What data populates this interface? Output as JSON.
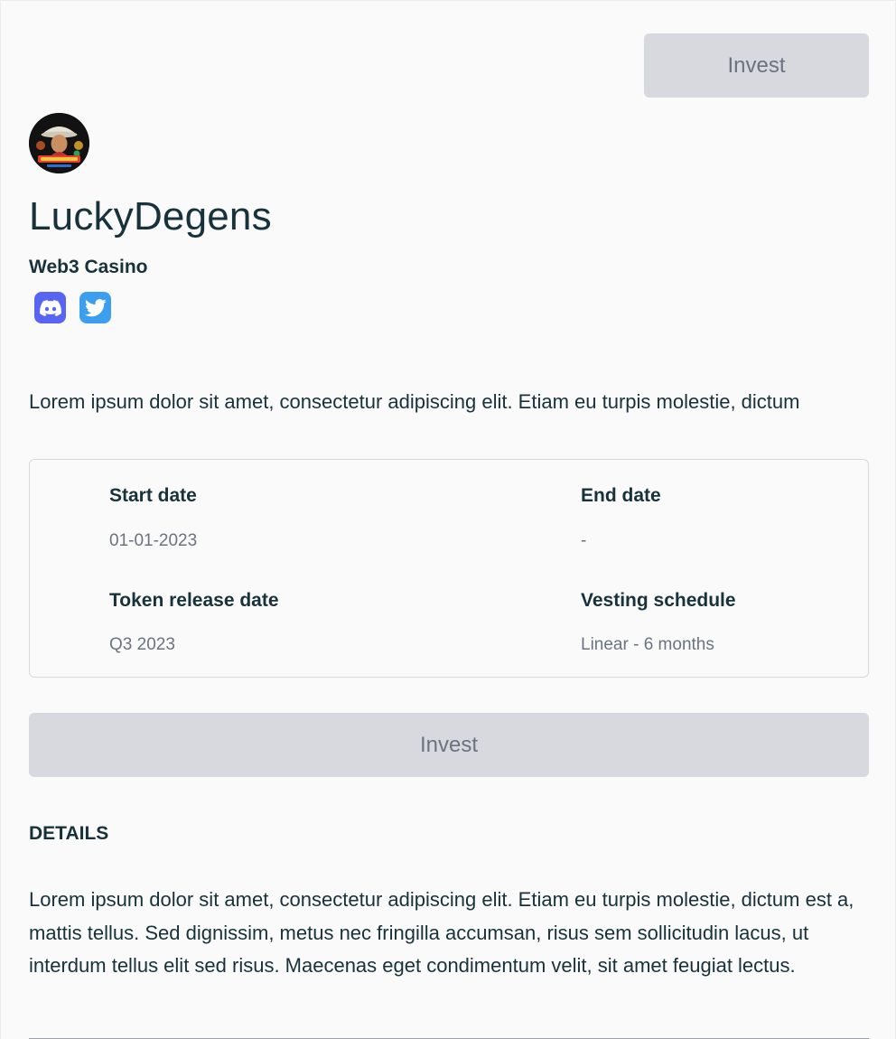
{
  "header": {
    "invest_label": "Invest"
  },
  "project": {
    "name": "LuckyDegens",
    "category": "Web3 Casino",
    "short_description": "Lorem ipsum dolor sit amet, consectetur adipiscing elit. Etiam eu turpis molestie, dictum",
    "socials": [
      {
        "icon": "discord-icon",
        "color": "#5865f2"
      },
      {
        "icon": "twitter-icon",
        "color": "#3d9ef0"
      }
    ]
  },
  "info": {
    "start_date_label": "Start date",
    "start_date_value": "01-01-2023",
    "end_date_label": "End date",
    "end_date_value": "-",
    "token_release_label": "Token release date",
    "token_release_value": "Q3 2023",
    "vesting_label": "Vesting schedule",
    "vesting_value": "Linear - 6 months"
  },
  "main": {
    "invest_label": "Invest"
  },
  "details": {
    "heading": "DETAILS",
    "text": "Lorem ipsum dolor sit amet, consectetur adipiscing elit. Etiam eu turpis molestie, dictum est a, mattis tellus. Sed dignissim, metus nec fringilla accumsan, risus sem sollicitudin lacus, ut interdum tellus elit sed risus. Maecenas eget condimentum velit, sit amet feugiat lectus."
  },
  "colors": {
    "button_bg": "#d8d9de",
    "text_primary": "#17323a",
    "text_muted": "#6b7280"
  }
}
